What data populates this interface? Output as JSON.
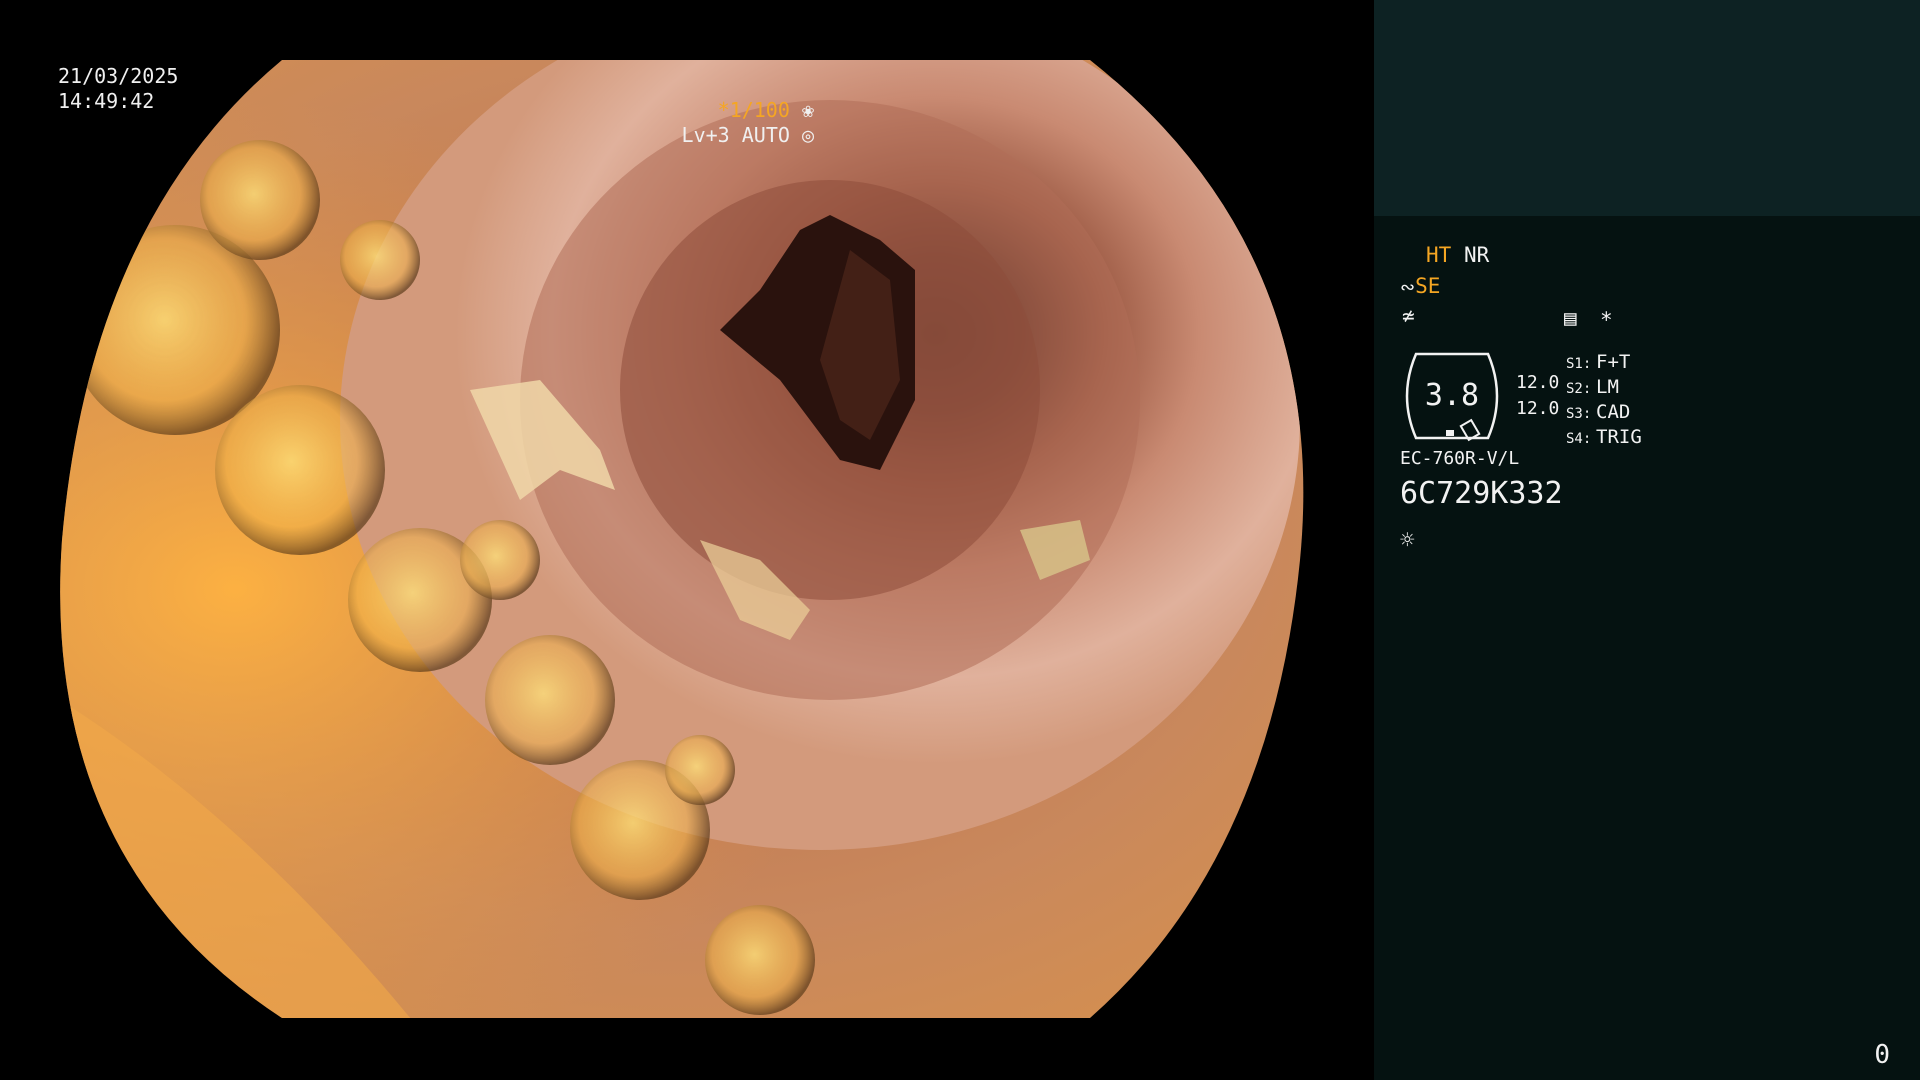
{
  "viewer": {
    "date": "21/03/2025",
    "time": "14:49:42",
    "shutter_prefix": "*",
    "shutter_value": "1/100",
    "level_label": "Lv+3 AUTO"
  },
  "panel": {
    "ht": "HT",
    "nr": "NR",
    "se": "SE",
    "star": "*",
    "gauge_value": "3.8",
    "val_a": "12.0",
    "val_b": "12.0",
    "scope_settings": [
      {
        "key": "S1:",
        "value": "F+T"
      },
      {
        "key": "S2:",
        "value": "LM"
      },
      {
        "key": "S3:",
        "value": "CAD"
      },
      {
        "key": "S4:",
        "value": "TRIG"
      }
    ],
    "model": "EC-760R-V/L",
    "serial": "6C729K332"
  },
  "footer": {
    "page_number": "0"
  },
  "colors": {
    "accent": "#f5a623",
    "panel_bg": "#051211",
    "panel_top_bg": "#0d2223"
  },
  "icons": [
    "aperture-icon",
    "iris-icon",
    "waterjet-icon",
    "zoom-icon",
    "document-icon",
    "light-icon"
  ]
}
